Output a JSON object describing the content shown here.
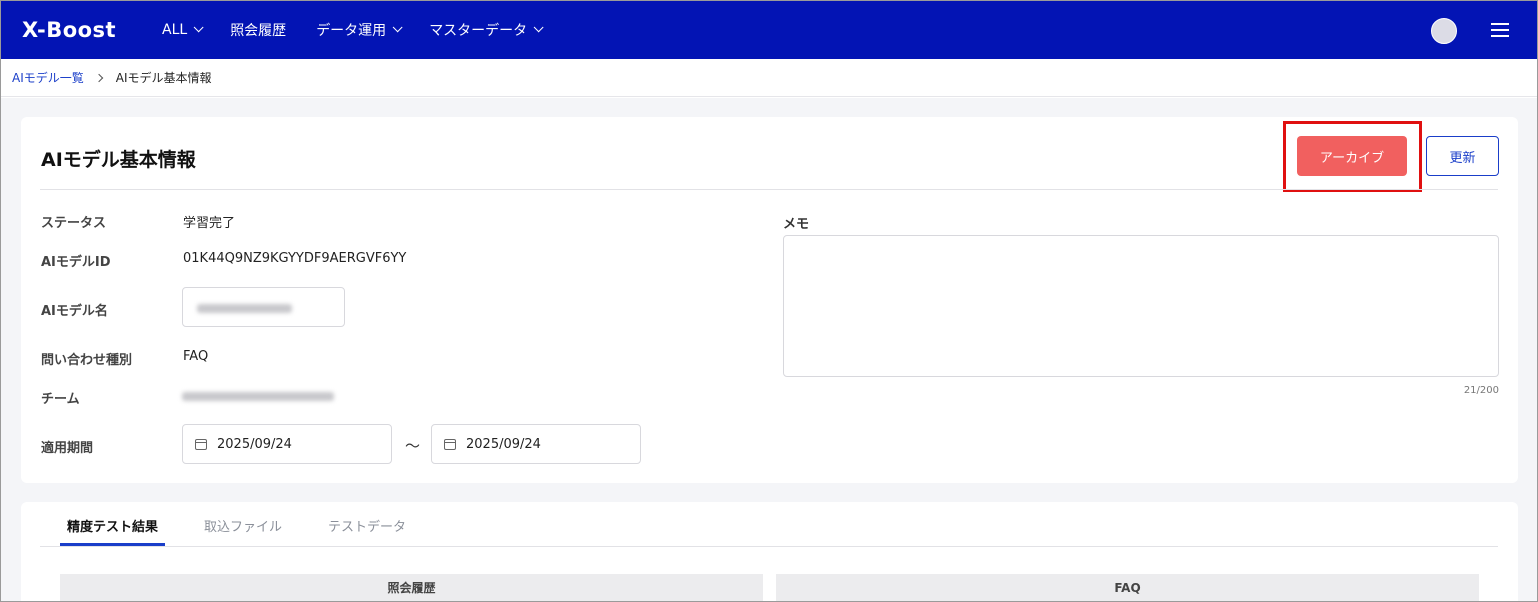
{
  "header": {
    "logo_text": "X-Boost",
    "nav": [
      {
        "label": "ALL",
        "has_dropdown": true
      },
      {
        "label": "照会履歴",
        "has_dropdown": false
      },
      {
        "label": "データ運用",
        "has_dropdown": true
      },
      {
        "label": "マスターデータ",
        "has_dropdown": true
      }
    ],
    "menu_icon": "hamburger-icon",
    "avatar_icon": "user-avatar"
  },
  "breadcrumb": {
    "parent": "AIモデル一覧",
    "current": "AIモデル基本情報"
  },
  "info_card": {
    "title": "AIモデル基本情報",
    "archive_button": "アーカイブ",
    "update_button": "更新",
    "fields": {
      "status": {
        "label": "ステータス",
        "value": "学習完了"
      },
      "model_id": {
        "label": "AIモデルID",
        "value": "01K44Q9NZ9KGYYDF9AERGVF6YY"
      },
      "model_name": {
        "label": "AIモデル名"
      },
      "inquiry_type": {
        "label": "問い合わせ種別",
        "value": "FAQ"
      },
      "team": {
        "label": "チーム"
      },
      "period": {
        "label": "適用期間",
        "start": "2025/09/24",
        "separator": "～",
        "end": "2025/09/24"
      }
    },
    "memo": {
      "label": "メモ",
      "count": "21/200"
    }
  },
  "tabs_card": {
    "tabs": [
      {
        "label": "精度テスト結果",
        "active": true
      },
      {
        "label": "取込ファイル",
        "active": false
      },
      {
        "label": "テストデータ",
        "active": false
      }
    ],
    "table_headers": [
      "照会履歴",
      "FAQ"
    ]
  },
  "colors": {
    "header_bg": "#0314b4",
    "archive_button": "#f1605f",
    "accent": "#1a3ec9",
    "highlight": "#e01010"
  }
}
